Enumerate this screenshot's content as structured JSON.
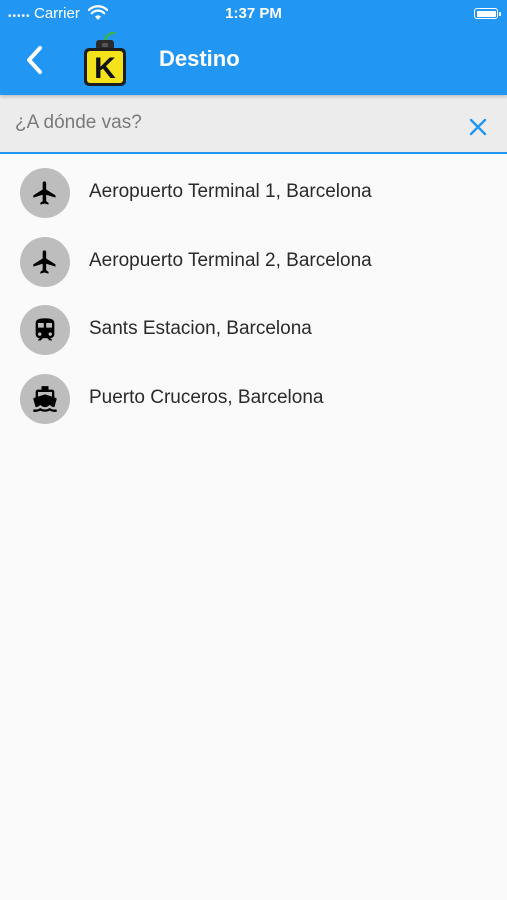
{
  "status": {
    "carrier": "Carrier",
    "time": "1:37 PM"
  },
  "appbar": {
    "title": "Destino",
    "color": "#2196f3",
    "logo_letter": "K"
  },
  "search": {
    "placeholder": "¿A dónde vas?",
    "value": ""
  },
  "destinations": [
    {
      "label": "Aeropuerto Terminal 1, Barcelona",
      "icon": "plane-icon"
    },
    {
      "label": "Aeropuerto Terminal 2, Barcelona",
      "icon": "plane-icon"
    },
    {
      "label": "Sants Estacion, Barcelona",
      "icon": "train-icon"
    },
    {
      "label": "Puerto Cruceros, Barcelona",
      "icon": "ship-icon"
    }
  ]
}
